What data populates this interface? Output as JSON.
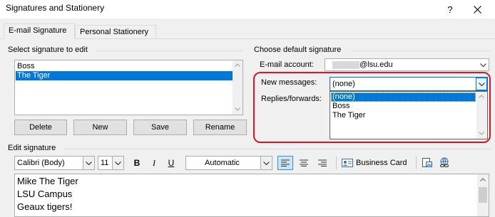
{
  "window": {
    "title": "Signatures and Stationery",
    "help_glyph": "?"
  },
  "tabs": [
    {
      "label": "E-mail Signature",
      "active": true
    },
    {
      "label": "Personal Stationery",
      "active": false
    }
  ],
  "select_signature": {
    "label": "Select signature to edit",
    "items": [
      {
        "label": "Boss",
        "selected": false
      },
      {
        "label": "The Tiger",
        "selected": true
      }
    ]
  },
  "signature_buttons": {
    "delete": "Delete",
    "new": "New",
    "save": "Save",
    "rename": "Rename"
  },
  "default_signature": {
    "label": "Choose default signature",
    "email_account_label": "E-mail account:",
    "email_account_value": "@lsu.edu",
    "new_messages_label": "New messages:",
    "new_messages_value": "(none)",
    "replies_label": "Replies/forwards:",
    "dropdown_options": [
      {
        "label": "(none)",
        "selected": true
      },
      {
        "label": "Boss",
        "selected": false
      },
      {
        "label": "The Tiger",
        "selected": false
      }
    ]
  },
  "edit_signature": {
    "label": "Edit signature",
    "font": "Calibri (Body)",
    "size": "11",
    "bold": "B",
    "italic": "I",
    "underline": "U",
    "color": "Automatic",
    "business_card": "Business Card",
    "body_lines": [
      "Mike The Tiger",
      "LSU Campus",
      "Geaux tigers!"
    ]
  },
  "colors": {
    "highlight": "#0078d7",
    "annotation_red": "#e3131b",
    "focus_blue": "#0078d7"
  },
  "icons": [
    "help-icon",
    "close-icon",
    "chevron-down-icon",
    "align-left-icon",
    "align-center-icon",
    "align-right-icon",
    "business-card-icon",
    "insert-picture-icon",
    "hyperlink-icon",
    "scroll-up-icon",
    "scroll-down-icon"
  ]
}
